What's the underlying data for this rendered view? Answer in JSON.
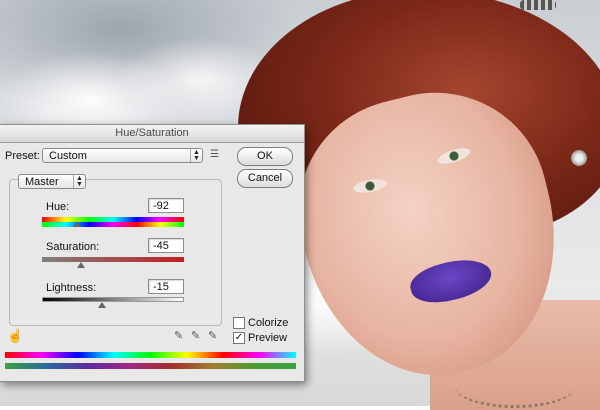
{
  "dialog": {
    "title": "Hue/Saturation",
    "preset_label": "Preset:",
    "preset_value": "Custom",
    "ok_label": "OK",
    "cancel_label": "Cancel",
    "channel_value": "Master",
    "colorize_label": "Colorize",
    "colorize_checked": false,
    "preview_label": "Preview",
    "preview_checked": true,
    "preview_check_glyph": "✓",
    "preset_options_icon": "list-icon",
    "hand_tool_icon": "targeted-adjustment-hand-icon",
    "eyedropper_icons": [
      "eyedropper-icon",
      "eyedropper-add-icon",
      "eyedropper-subtract-icon"
    ]
  },
  "sliders": {
    "hue": {
      "label": "Hue:",
      "value": "-92",
      "level": -92,
      "min": -180,
      "max": 180
    },
    "saturation": {
      "label": "Saturation:",
      "value": "-45",
      "level": -45,
      "min": -100,
      "max": 100
    },
    "lightness": {
      "label": "Lightness:",
      "value": "-15",
      "level": -15,
      "min": -100,
      "max": 100
    }
  },
  "colors": {
    "dialog_bg": "#e8e8e8",
    "lipstick": "#4b2aa0",
    "hair": "#7a2718"
  }
}
